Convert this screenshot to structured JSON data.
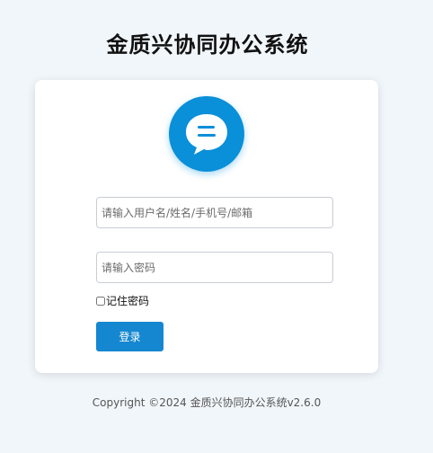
{
  "app": {
    "title": "金质兴协同办公系统"
  },
  "login": {
    "username_placeholder": "请输入用户名/姓名/手机号/邮箱",
    "username_value": "",
    "password_placeholder": "请输入密码",
    "password_value": "",
    "remember_label": "记住密码",
    "remember_checked": false,
    "submit_label": "登录"
  },
  "footer": {
    "copyright": "Copyright ©2024 金质兴协同办公系统v2.6.0"
  },
  "logo": {
    "icon": "chat-bubble-icon"
  },
  "colors": {
    "background": "#f1f6fa",
    "accent": "#1587d1",
    "logo": "#0a8fd9"
  }
}
